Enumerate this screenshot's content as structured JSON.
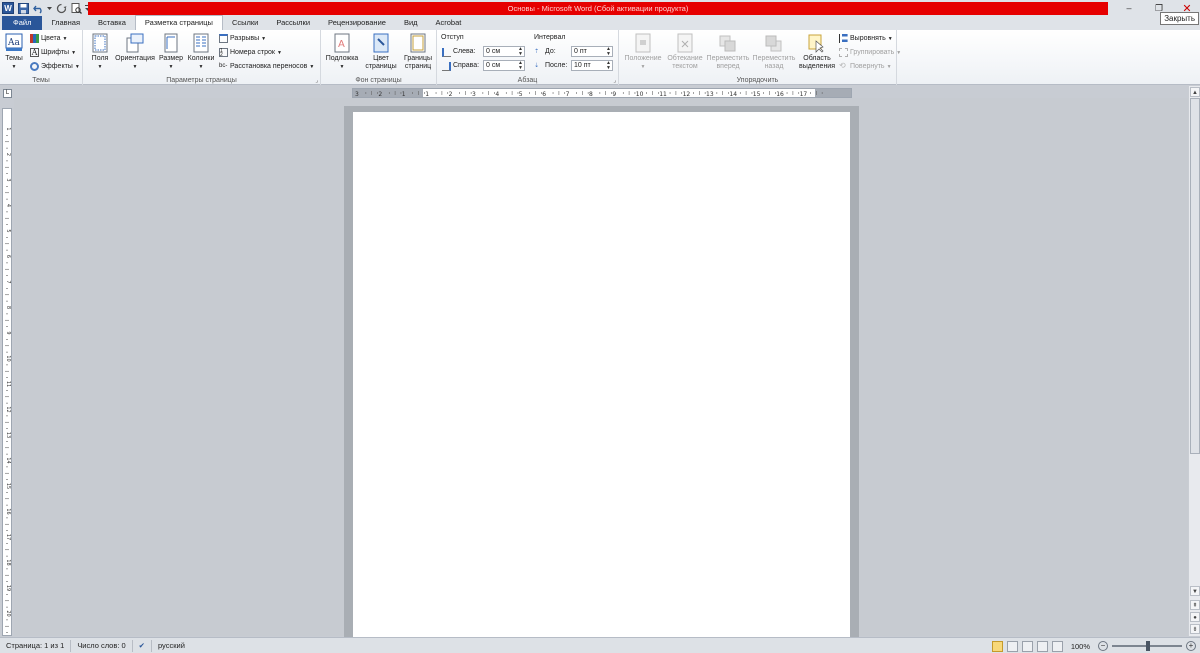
{
  "title": "Основы  -  Microsoft Word (Сбой активации продукта)",
  "tooltip": "Закрыть",
  "tabs": [
    "Файл",
    "Главная",
    "Вставка",
    "Разметка страницы",
    "Ссылки",
    "Рассылки",
    "Рецензирование",
    "Вид",
    "Acrobat"
  ],
  "ribbon": {
    "themes": {
      "label": "Темы",
      "button": "Темы",
      "colors": "Цвета",
      "fonts": "Шрифты",
      "effects": "Эффекты"
    },
    "page_setup": {
      "label": "Параметры страницы",
      "fields": "Поля",
      "orientation": "Ориентация",
      "size": "Размер",
      "columns": "Колонки",
      "breaks": "Разрывы",
      "line_numbers": "Номера строк",
      "hyphenation": "Расстановка переносов"
    },
    "page_background": {
      "label": "Фон страницы",
      "watermark": "Подложка",
      "page_color": "Цвет страницы",
      "page_borders": "Границы страниц"
    },
    "paragraph": {
      "label": "Абзац",
      "indent": "Отступ",
      "left": "Слева:",
      "left_val": "0 см",
      "right": "Справа:",
      "right_val": "0 см",
      "spacing": "Интервал",
      "before": "До:",
      "before_val": "0 пт",
      "after": "После:",
      "after_val": "10 пт"
    },
    "arrange": {
      "label": "Упорядочить",
      "position": "Положение",
      "wrap": "Обтекание текстом",
      "forward": "Переместить вперед",
      "backward": "Переместить назад",
      "selection": "Область выделения",
      "align": "Выровнять",
      "group": "Группировать",
      "rotate": "Повернуть"
    }
  },
  "ruler_numbers": [
    "3",
    "2",
    "1",
    "1",
    "2",
    "3",
    "4",
    "5",
    "6",
    "7",
    "8",
    "9",
    "10",
    "11",
    "12",
    "13",
    "14",
    "15",
    "16",
    "17"
  ],
  "vruler_numbers": [
    "1",
    "2",
    "3",
    "4",
    "5",
    "6",
    "7",
    "8",
    "9",
    "10",
    "11",
    "12",
    "13",
    "14",
    "15",
    "16",
    "17",
    "18",
    "19",
    "20"
  ],
  "status": {
    "page": "Страница: 1 из 1",
    "words": "Число слов: 0",
    "lang": "русский",
    "zoom": "100%"
  }
}
